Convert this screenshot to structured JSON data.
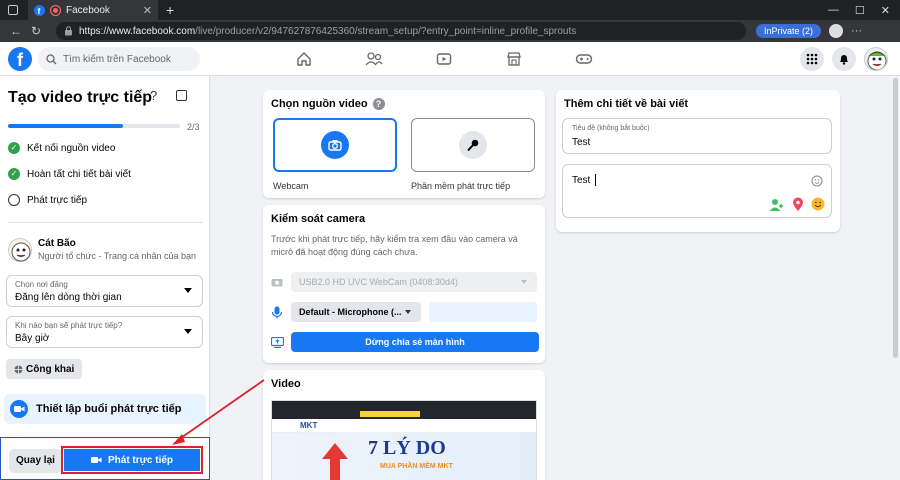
{
  "browser": {
    "tab_title": "Facebook",
    "url_host": "https://www.facebook.com",
    "url_path": "/live/producer/v2/947627876425360/stream_setup/?entry_point=inline_profile_sprouts",
    "inprivate_label": "InPrivate (2)"
  },
  "fb": {
    "logo_letter": "f",
    "search_placeholder": "Tìm kiếm trên Facebook"
  },
  "left": {
    "title": "Tạo video trực tiếp",
    "progress_label": "2/3",
    "progress_fraction": 0.67,
    "steps": [
      {
        "label": "Kết nối nguồn video",
        "done": true
      },
      {
        "label": "Hoàn tất chi tiết bài viết",
        "done": true
      },
      {
        "label": "Phát trực tiếp",
        "done": false
      }
    ],
    "host_name": "Cát Bão",
    "host_sub": "Người tổ chức - Trang cá nhân của bạn",
    "post_location": {
      "label": "Chọn nơi đăng",
      "value": "Đăng lên dòng thời gian"
    },
    "schedule": {
      "label": "Khi nào bạn sẽ phát trực tiếp?",
      "value": "Bây giờ"
    },
    "privacy": "Công khai",
    "setup_label": "Thiết lập buổi phát trực tiếp",
    "back_label": "Quay lại",
    "go_live_label": "Phát trực tiếp"
  },
  "middle": {
    "source_title": "Chọn nguồn video",
    "webcam_label": "Webcam",
    "software_label": "Phần mềm phát trực tiếp",
    "camera_title": "Kiểm soát camera",
    "camera_desc": "Trước khi phát trực tiếp, hãy kiểm tra xem đầu vào camera và micrô đã hoạt động đúng cách chưa.",
    "camera_device": "USB2.0 HD UVC WebCam (0408:30d4)",
    "mic_device": "Default - Microphone (...",
    "stop_share_label": "Dừng chia sẻ màn hình",
    "video_title": "Video",
    "preview_big": "7 LÝ DO",
    "preview_sub": "MUA PHẦN MỀM MKT",
    "preview_brand": "MKT"
  },
  "right": {
    "title": "Thêm chi tiết về bài viết",
    "title_field_label": "Tiêu đề (không bắt buộc)",
    "title_field_value": "Test",
    "desc_value": "Test"
  },
  "colors": {
    "fb_blue": "#1877f2",
    "check_green": "#31a24c",
    "annotation_red": "#d9232d"
  }
}
